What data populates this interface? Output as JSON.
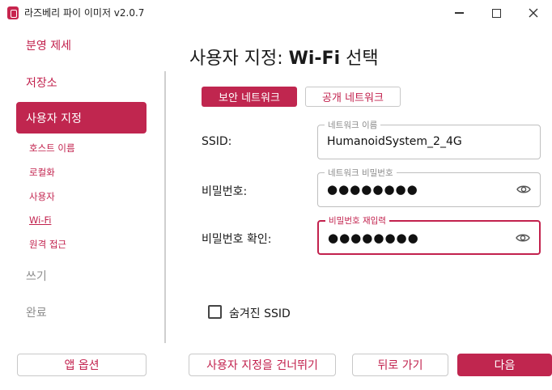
{
  "window": {
    "title": "라즈베리 파이 이미저 v2.0.7",
    "accent_color": "#c0264f"
  },
  "sidebar": {
    "items": [
      {
        "label": "분영 제세",
        "state": "done"
      },
      {
        "label": "저장소",
        "state": "done"
      },
      {
        "label": "사용자 지정",
        "state": "active"
      },
      {
        "label": "쓰기",
        "state": "pending"
      },
      {
        "label": "완료",
        "state": "pending"
      }
    ],
    "subitems": [
      {
        "label": "호스트 이름"
      },
      {
        "label": "로컬화"
      },
      {
        "label": "사용자"
      },
      {
        "label": "Wi-Fi",
        "current": true
      },
      {
        "label": "원격 접근"
      }
    ]
  },
  "main": {
    "title_prefix": "사용자 지정: ",
    "title_bold": "Wi-Fi",
    "title_suffix": " 선택",
    "tabs": [
      {
        "label": "보안 네트워크",
        "selected": true
      },
      {
        "label": "공개 네트워크",
        "selected": false
      }
    ],
    "ssid": {
      "label": "SSID:",
      "legend": "네트워크 이름",
      "value": "HumanoidSystem_2_4G"
    },
    "password": {
      "label": "비밀번호:",
      "legend": "네트워크 비밀번호",
      "masked": "●●●●●●●●",
      "icon": "eye-icon"
    },
    "confirm": {
      "label": "비밀번호 확인:",
      "legend": "비밀번호 재입력",
      "masked": "●●●●●●●●",
      "icon": "eye-icon"
    },
    "hidden_ssid": {
      "label": "숨겨진 SSID",
      "checked": false
    }
  },
  "footer": {
    "options_label": "앱 옵션",
    "skip_label": "사용자 지정을 건너뛰기",
    "back_label": "뒤로 가기",
    "next_label": "다음"
  }
}
